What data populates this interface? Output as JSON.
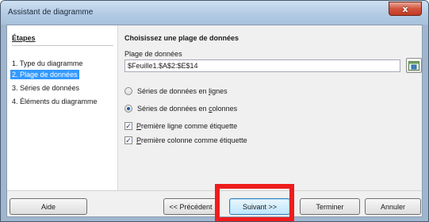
{
  "window": {
    "title": "Assistant de diagramme",
    "close_glyph": "x"
  },
  "steps": {
    "title": "Étapes",
    "items": [
      {
        "label": "1. Type du diagramme",
        "active": false
      },
      {
        "label": "2. Plage de données",
        "active": true
      },
      {
        "label": "3. Séries de données",
        "active": false
      },
      {
        "label": "4. Éléments du diagramme",
        "active": false
      }
    ]
  },
  "main": {
    "title": "Choisissez une plage de données",
    "range_label": "Plage de données",
    "range_value": "$Feuille1.$A$2:$E$14",
    "shrink_icon": "shrink-range-icon",
    "radio_lines": {
      "prefix": "Séries de données en ",
      "key": "l",
      "rest": "ignes",
      "selected": false
    },
    "radio_cols": {
      "prefix": "Séries de données en ",
      "key": "c",
      "rest": "olonnes",
      "selected": true
    },
    "check_first_row": {
      "key": "P",
      "rest": "remière ligne comme étiquette",
      "checked": true
    },
    "check_first_col": {
      "key": "P",
      "rest": "remière colonne comme étiquette",
      "checked": true
    }
  },
  "buttons": {
    "help": "Aide",
    "prev": "<< Précédent",
    "next": "Suivant >>",
    "finish": "Terminer",
    "cancel": "Annuler"
  },
  "colors": {
    "selection": "#3399ff",
    "highlight_box": "#ef1c1c"
  }
}
